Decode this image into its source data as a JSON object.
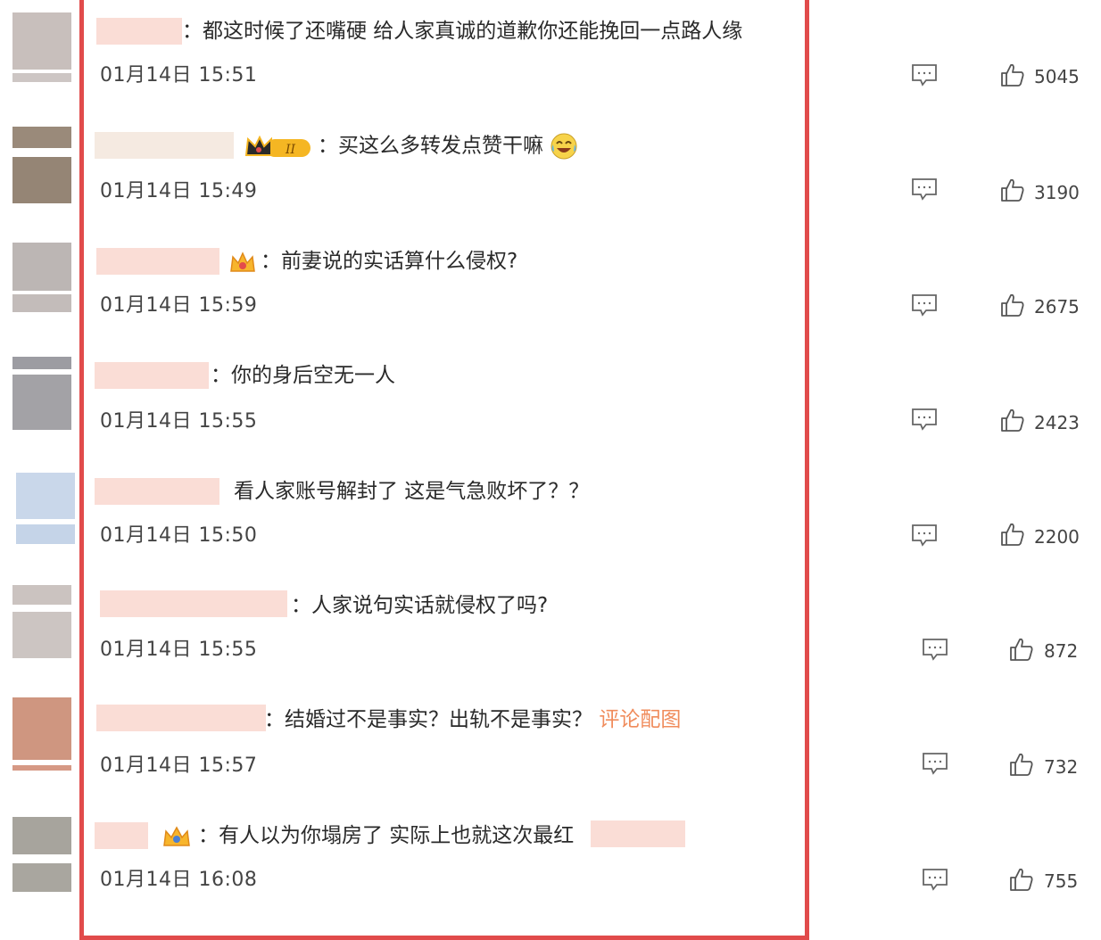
{
  "comments": [
    {
      "text": "都这时候了还嘴硬 给人家真诚的道歉你还能挽回一点路人缘",
      "time": "01月14日 15:51",
      "likes": "5045"
    },
    {
      "text": "买这么多转发点赞干嘛",
      "time": "01月14日 15:49",
      "likes": "3190"
    },
    {
      "text": "前妻说的实话算什么侵权?",
      "time": "01月14日 15:59",
      "likes": "2675"
    },
    {
      "text": "你的身后空无一人",
      "time": "01月14日 15:55",
      "likes": "2423"
    },
    {
      "text": "看人家账号解封了 这是气急败坏了？？",
      "time": "01月14日 15:50",
      "likes": "2200"
    },
    {
      "text": "人家说句实话就侵权了吗?",
      "time": "01月14日 15:55",
      "likes": "872"
    },
    {
      "text": "结婚过不是事实？出轨不是事实？",
      "pic_link": "评论配图",
      "time": "01月14日 15:57",
      "likes": "732"
    },
    {
      "text": "有人以为你塌房了 实际上也就这次最红",
      "time": "01月14日 16:08",
      "likes": "755"
    }
  ],
  "separator": "："
}
